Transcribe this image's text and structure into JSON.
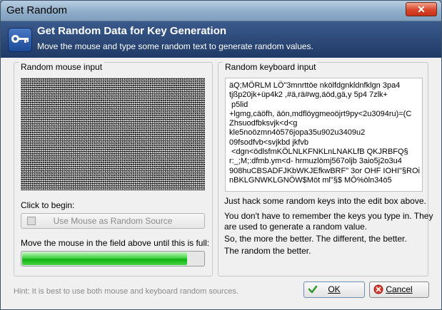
{
  "window": {
    "title": "Get Random",
    "close_glyph": "✕"
  },
  "header": {
    "title": "Get Random Data for Key Generation",
    "subtitle": "Move the mouse and type some random text to generate random values.",
    "icon": "key-icon"
  },
  "mouse_panel": {
    "label": "Random mouse input",
    "click_to_begin": "Click to begin:",
    "use_mouse_button": "Use Mouse as Random Source",
    "progress_label": "Move the mouse in the field above until this is full:",
    "progress_fraction": 0.91
  },
  "keyboard_panel": {
    "label": "Random keyboard input",
    "text": "äQ;MÖRLM LÖ\"3mnrttöe nkölfdgnkldnfklgn 3pa4\ntjßp20jk+üp4k2 ,#ä,rä#wg,äöd,gä,y 5p4 7zlk+\n p5lid\n+lgmg,cäöfh, äön,mdflöygmeoöjrt9py<2u3094ru)=(C\nZhsuodfbksvjk<d<g\nkle5noözmn4ö576jopa35u902u3409u2\n09fsodfvb<svjkbd jkfvb\n <dgn<ödlsfmKÖLNLKFNKLnLNAKLfB QKJRBFQ§\nr:_;M;:dfmb.ym<d- hrmuzlömj567oljb 3aio5j2o3u4\n908huCBSADFJKbWKJEfkwBRF\" 3or OHF IOHI\"§ROi\nnBKLGNWKLGNÖW$Möt ml\"§$ MÖ%öln34ö5",
    "info": [
      "Just hack some random keys into the edit box above.",
      "You don't have to remember the keys you type in. They",
      "are used to generate a random value.",
      "So, the more the better. The different, the better.",
      "The random the better."
    ]
  },
  "footer": {
    "hint": "Hint: It is best to use both mouse and keyboard random sources.",
    "ok": "OK",
    "cancel": "Cancel",
    "ok_icon": "checkmark-icon",
    "cancel_icon": "cancel-icon"
  }
}
